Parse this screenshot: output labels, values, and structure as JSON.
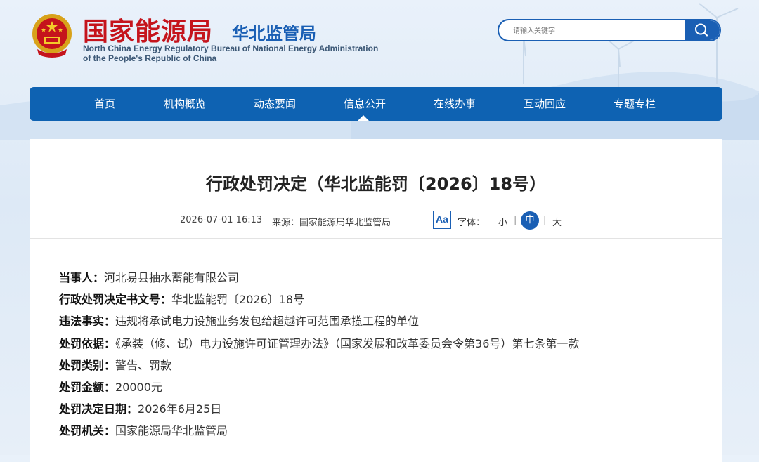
{
  "header": {
    "site_name": "国家能源局",
    "bureau_name": "华北监管局",
    "english_line1": "North China Energy Regulatory Bureau of National Energy Administration",
    "english_line2": "of the People's Republic of China",
    "emblem_icon": "national-emblem-icon"
  },
  "search": {
    "placeholder": "请输入关键字",
    "icon": "search-icon"
  },
  "nav": {
    "items": [
      "首页",
      "机构概览",
      "动态要闻",
      "信息公开",
      "在线办事",
      "互动回应",
      "专题专栏"
    ],
    "active_index": 3
  },
  "article": {
    "title": "行政处罚决定（华北监能罚〔2026〕18号）",
    "date": "2026-07-01 16:13",
    "source_label": "来源：",
    "source": "国家能源局华北监管局",
    "font_icon_text": "Aa",
    "font_label": "字体：",
    "font_small": "小",
    "font_medium": "中",
    "font_large": "大",
    "separator": "|"
  },
  "fields": [
    {
      "label": "当事人：",
      "value": "河北易县抽水蓄能有限公司"
    },
    {
      "label": "行政处罚决定书文号：",
      "value": "华北监能罚〔2026〕18号"
    },
    {
      "label": "违法事实：",
      "value": "违规将承试电力设施业务发包给超越许可范围承揽工程的单位"
    },
    {
      "label": "处罚依据：",
      "value": "《承装（修、试）电力设施许可证管理办法》（国家发展和改革委员会令第36号）第七条第一款"
    },
    {
      "label": "处罚类别：",
      "value": "警告、罚款"
    },
    {
      "label": "处罚金额：",
      "value": "20000元"
    },
    {
      "label": "处罚决定日期：",
      "value": "2026年6月25日"
    },
    {
      "label": "处罚机关：",
      "value": "国家能源局华北监管局"
    }
  ],
  "colors": {
    "brand_red": "#c5141c",
    "brand_blue": "#1a5fb4",
    "nav_blue": "#0e62b2"
  }
}
